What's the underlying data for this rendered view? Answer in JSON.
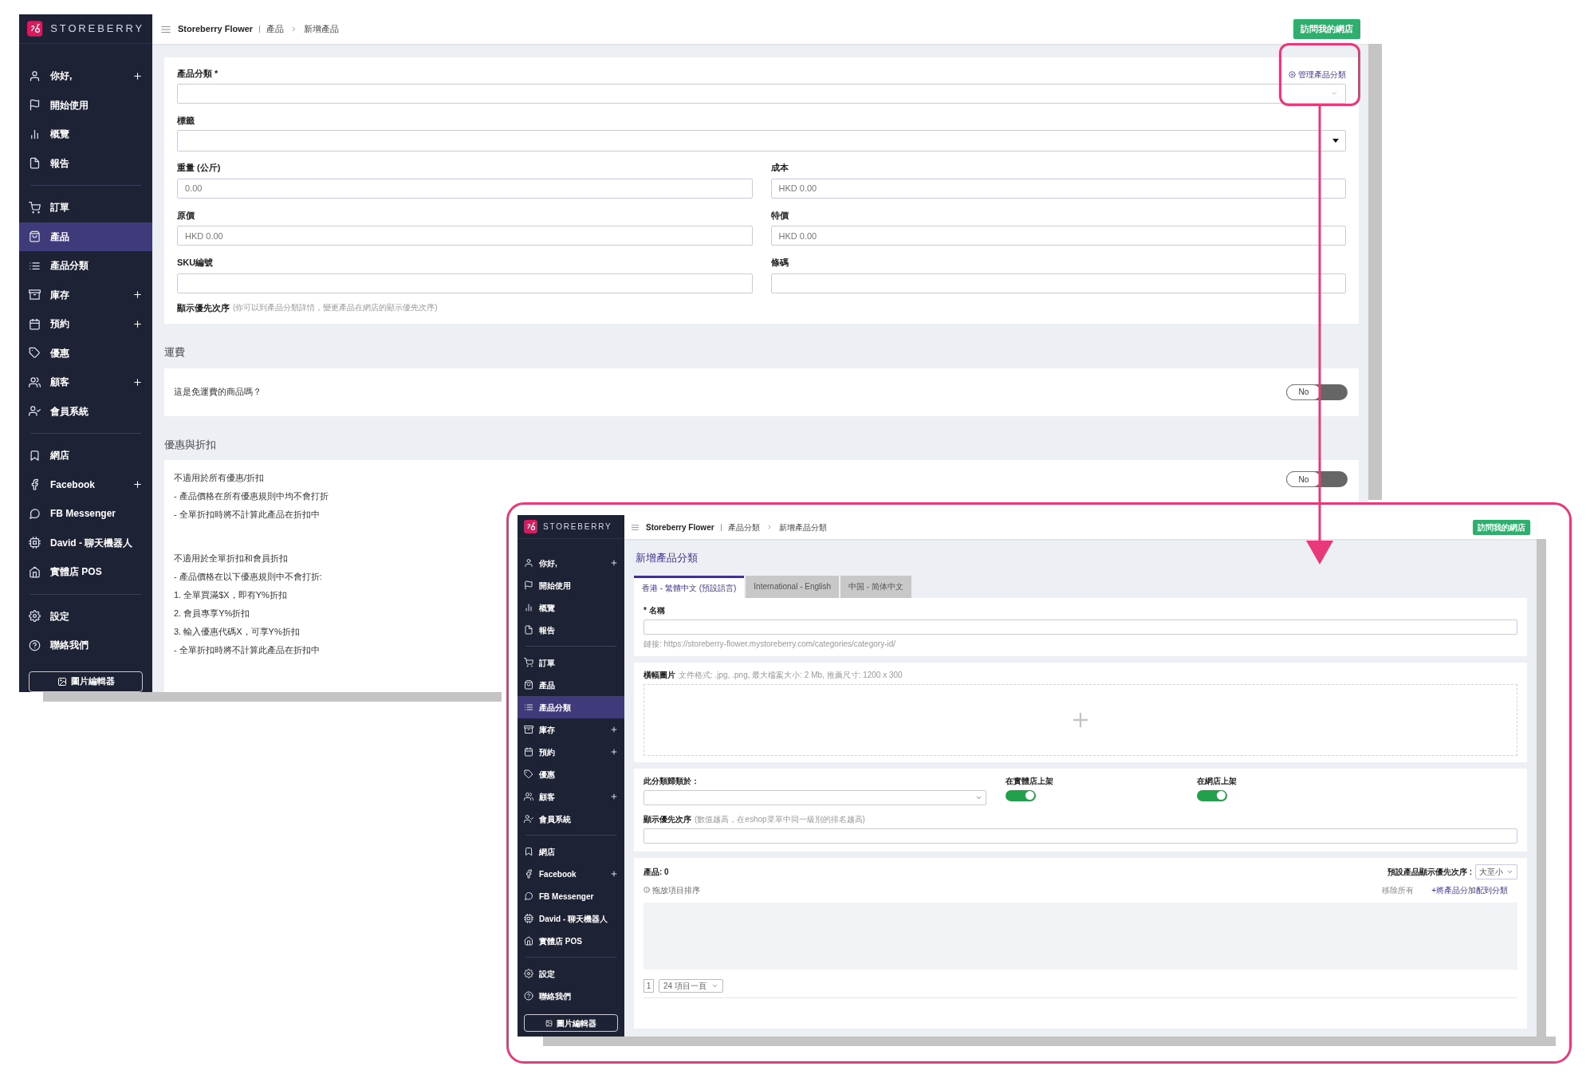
{
  "product_window": {
    "logo": "STOREBERRY",
    "sidebar": {
      "sections": [
        {
          "items": [
            {
              "label": "你好,",
              "expandable": true,
              "selected": false
            },
            {
              "label": "開始使用",
              "expandable": false,
              "selected": false
            },
            {
              "label": "概覽",
              "expandable": false,
              "selected": false
            },
            {
              "label": "報告",
              "expandable": false,
              "selected": false
            }
          ]
        },
        {
          "items": [
            {
              "label": "訂單",
              "expandable": false,
              "selected": false
            },
            {
              "label": "產品",
              "expandable": false,
              "selected": true
            },
            {
              "label": "產品分類",
              "expandable": false,
              "selected": false
            },
            {
              "label": "庫存",
              "expandable": true,
              "selected": false
            },
            {
              "label": "預約",
              "expandable": true,
              "selected": false
            },
            {
              "label": "優惠",
              "expandable": false,
              "selected": false
            },
            {
              "label": "顧客",
              "expandable": true,
              "selected": false
            },
            {
              "label": "會員系統",
              "expandable": false,
              "selected": false
            }
          ]
        },
        {
          "items": [
            {
              "label": "網店",
              "expandable": false,
              "selected": false
            },
            {
              "label": "Facebook",
              "expandable": true,
              "selected": false
            },
            {
              "label": "FB Messenger",
              "expandable": false,
              "selected": false
            },
            {
              "label": "David - 聊天機器人",
              "expandable": false,
              "selected": false
            },
            {
              "label": "實體店 POS",
              "expandable": false,
              "selected": false
            }
          ]
        },
        {
          "items": [
            {
              "label": "設定",
              "expandable": false,
              "selected": false
            },
            {
              "label": "聯絡我們",
              "expandable": false,
              "selected": false
            }
          ]
        }
      ],
      "footer_button": "圖片編輯器"
    },
    "breadcrumb": [
      "Storeberry Flower",
      "產品",
      "新增產品"
    ],
    "visit_button": "訪問我的網店",
    "form": {
      "category": {
        "label": "產品分類 *",
        "link": "管理產品分類"
      },
      "tags": {
        "label": "標籤"
      },
      "fields": [
        {
          "label": "重量 (公斤)",
          "placeholder": "0.00"
        },
        {
          "label": "成本",
          "placeholder": "HKD 0.00"
        },
        {
          "label": "原價",
          "placeholder": "HKD 0.00"
        },
        {
          "label": "特價",
          "placeholder": "HKD 0.00"
        },
        {
          "label": "SKU編號"
        },
        {
          "label": "條碼"
        }
      ],
      "display_order": {
        "label": "顯示優先次序",
        "hint": "(你可以到產品分類詳情，變更產品在網店的顯示優先次序)"
      }
    },
    "shipping": {
      "title": "運費",
      "question": "這是免運費的商品嗎？",
      "toggle": {
        "label": "No",
        "on": false
      }
    },
    "discount": {
      "title": "優惠與折扣",
      "toggle": {
        "label": "No",
        "on": false
      },
      "blocks": [
        {
          "lines": [
            "不適用於所有優惠/折扣",
            "- 產品價格在所有優惠規則中均不會打折",
            "- 全單折扣時將不計算此產品在折扣中"
          ]
        },
        {
          "lines": [
            "不適用於全單折扣和會員折扣",
            "- 產品價格在以下優惠規則中不會打折:",
            "1. 全單買滿$X，即有Y%折扣",
            "2. 會員專享Y%折扣",
            "3. 輸入優惠代碼X，可享Y%折扣",
            "- 全單折扣時將不計算此產品在折扣中"
          ]
        }
      ]
    }
  },
  "category_window": {
    "logo": "STOREBERRY",
    "sidebar": {
      "sections": [
        {
          "items": [
            {
              "label": "你好,",
              "expandable": true,
              "selected": false
            },
            {
              "label": "開始使用",
              "expandable": false,
              "selected": false
            },
            {
              "label": "概覽",
              "expandable": false,
              "selected": false
            },
            {
              "label": "報告",
              "expandable": false,
              "selected": false
            }
          ]
        },
        {
          "items": [
            {
              "label": "訂單",
              "expandable": false,
              "selected": false
            },
            {
              "label": "產品",
              "expandable": false,
              "selected": false
            },
            {
              "label": "產品分類",
              "expandable": false,
              "selected": true
            },
            {
              "label": "庫存",
              "expandable": true,
              "selected": false
            },
            {
              "label": "預約",
              "expandable": true,
              "selected": false
            },
            {
              "label": "優惠",
              "expandable": false,
              "selected": false
            },
            {
              "label": "顧客",
              "expandable": true,
              "selected": false
            },
            {
              "label": "會員系統",
              "expandable": false,
              "selected": false
            }
          ]
        },
        {
          "items": [
            {
              "label": "網店",
              "expandable": false,
              "selected": false
            },
            {
              "label": "Facebook",
              "expandable": true,
              "selected": false
            },
            {
              "label": "FB Messenger",
              "expandable": false,
              "selected": false
            },
            {
              "label": "David - 聊天機器人",
              "expandable": false,
              "selected": false
            },
            {
              "label": "實體店 POS",
              "expandable": false,
              "selected": false
            }
          ]
        },
        {
          "items": [
            {
              "label": "設定",
              "expandable": false,
              "selected": false
            },
            {
              "label": "聯絡我們",
              "expandable": false,
              "selected": false
            }
          ]
        }
      ],
      "footer_button": "圖片編輯器"
    },
    "breadcrumb": [
      "Storeberry Flower",
      "產品分類",
      "新增產品分類"
    ],
    "visit_button": "訪問我的網店",
    "title": "新增產品分類",
    "tabs": [
      {
        "label": "香港 - 繁體中文 (預設語言)",
        "selected": true
      },
      {
        "label": "International - English",
        "selected": false
      },
      {
        "label": "中国 - 简体中文",
        "selected": false
      }
    ],
    "name": {
      "label": "* 名稱",
      "link_hint": "鏈接: https://storeberry-flower.mystoreberry.com/categories/category-id/"
    },
    "banner": {
      "label": "橫幅圖片",
      "hint": "文件格式: .jpg, .png, 最大檔案大小: 2 Mb, 推薦尺寸: 1200 x 300"
    },
    "parent": {
      "label": "此分類歸類於："
    },
    "toggles": [
      {
        "label": "在實體店上架",
        "on": true
      },
      {
        "label": "在網店上架",
        "on": true
      }
    ],
    "display_order": {
      "label": "顯示優先次序",
      "hint": "(數值越高，在eshop菜單中同一級別的排名越高)"
    },
    "products": {
      "count": "產品: 0",
      "sort_label": "預設產品顯示優先次序 :",
      "sort_value": "大至小",
      "drag_hint": "拖放項目排序",
      "remove_all": "移除所有",
      "add_link": "+將產品分加配到分類",
      "page": "1",
      "per_page": "24 項目一頁"
    }
  }
}
